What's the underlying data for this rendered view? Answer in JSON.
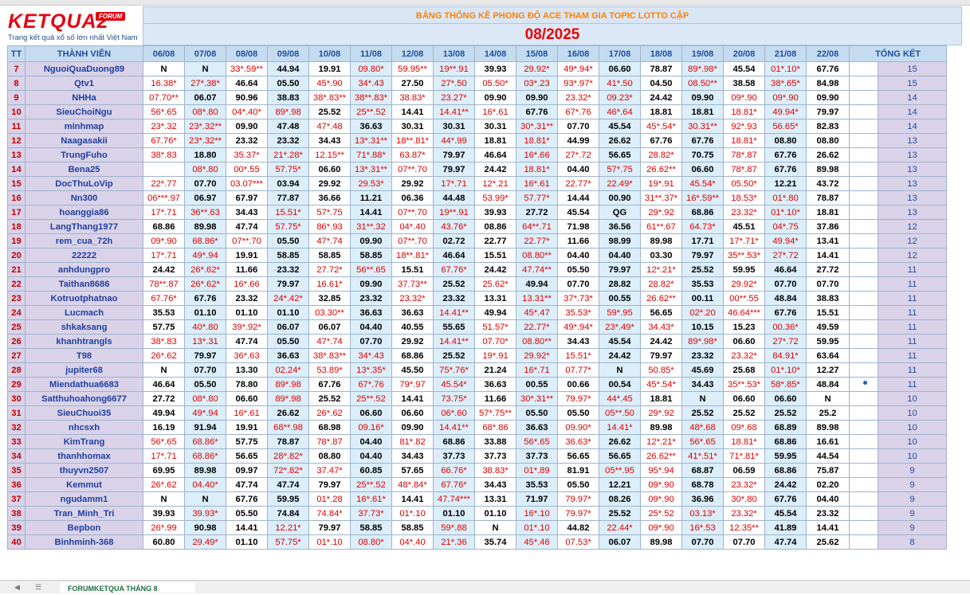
{
  "logo": {
    "main": "KETQUA2",
    "forum": "FORUM",
    "tagline": "Trang kết quả xổ số lớn nhất Việt Nam"
  },
  "title": "BẢNG THỐNG KÊ PHONG ĐỘ ACE THAM GIA TOPIC  LOTTO CẶP",
  "month": "08/2025",
  "headers": {
    "tt": "TT",
    "member": "THÀNH VIÊN",
    "total": "TỔNG KẾT"
  },
  "dates": [
    "06/08",
    "07/08",
    "08/08",
    "09/08",
    "10/08",
    "11/08",
    "12/08",
    "13/08",
    "14/08",
    "15/08",
    "16/08",
    "17/08",
    "18/08",
    "19/08",
    "20/08",
    "21/08",
    "22/08"
  ],
  "rows": [
    {
      "tt": "7",
      "name": "NguoiQuaDuong89",
      "cells": [
        "N",
        "N",
        "33*.59**",
        "44.94",
        "19.91",
        "09.80*",
        "59.95**",
        "19**.91",
        "39.93",
        "29.92*",
        "49*.94*",
        "06.60",
        "78.87",
        "89*.98*",
        "45.54",
        "01*.10*",
        "67.76"
      ],
      "total": "15"
    },
    {
      "tt": "8",
      "name": "Qtv1",
      "cells": [
        "16.38*",
        "27*.38*",
        "46.64",
        "05.50",
        "45*.90",
        "34*.43",
        "27.50",
        "27*.50",
        "05.50*",
        "03*.23",
        "93*.97*",
        "41*.50",
        "04.50",
        "08.50**",
        "38.58",
        "38*.65*",
        "84.98"
      ],
      "total": "15"
    },
    {
      "tt": "9",
      "name": "NHHa",
      "cells": [
        "07.70**",
        "06.07",
        "90.96",
        "38.83",
        "38*.83**",
        "38**.83*",
        "38.83*",
        "23.27*",
        "09.90",
        "09.90",
        "23.32*",
        "09.23*",
        "24.42",
        "09.90",
        "09*.90",
        "09*.90",
        "09.90"
      ],
      "total": "14"
    },
    {
      "tt": "10",
      "name": "SieuChoiNgu",
      "cells": [
        "56*.65",
        "08*.80",
        "04*.40*",
        "89*.98",
        "25.52",
        "25**.52",
        "14.41",
        "14.41**",
        "16*.61",
        "67.76",
        "67*.76",
        "46*.64",
        "18.81",
        "18.81",
        "18.81*",
        "49.94*",
        "79.97"
      ],
      "total": "14"
    },
    {
      "tt": "11",
      "name": "minhmap",
      "cells": [
        "23*.32",
        "23*.32**",
        "09.90",
        "47.48",
        "47*.48",
        "36.63",
        "30.31",
        "30.31",
        "30.31",
        "30*.31**",
        "07.70",
        "45.54",
        "45*.54*",
        "30.31**",
        "92*.93",
        "56.65*",
        "82.83"
      ],
      "total": "14"
    },
    {
      "tt": "12",
      "name": "Naagasakii",
      "cells": [
        "67.76*",
        "23*.32**",
        "23.32",
        "23.32",
        "34.43",
        "13*.31**",
        "18**.81*",
        "44*.99",
        "18.81",
        "18.81*",
        "44.99",
        "26.62",
        "67.76",
        "67.76",
        "18.81*",
        "08.80",
        "08.80"
      ],
      "total": "13"
    },
    {
      "tt": "13",
      "name": "TrungFuho",
      "cells": [
        "38*.83",
        "18.80",
        "35.37*",
        "21*.28*",
        "12.15**",
        "71*.88*",
        "63.87*",
        "79.97",
        "46.64",
        "16*.66",
        "27*.72",
        "56.65",
        "28.82*",
        "70.75",
        "78*.87",
        "67.76",
        "26.62"
      ],
      "total": "13"
    },
    {
      "tt": "14",
      "name": "Bena25",
      "cells": [
        "",
        "08*.80",
        "00*.55",
        "57.75*",
        "06.60",
        "13*.31**",
        "07**.70",
        "79.97",
        "24.42",
        "18.81*",
        "04.40",
        "57*.75",
        "26.62**",
        "06.60",
        "78*.87",
        "67.76",
        "89.98"
      ],
      "total": "13"
    },
    {
      "tt": "15",
      "name": "DocThuLoVip",
      "cells": [
        "22*.77",
        "07.70",
        "03.07***",
        "03.94",
        "29.92",
        "29.53*",
        "29.92",
        "17*.71",
        "12*.21",
        "16*.61",
        "22.77*",
        "22.49*",
        "19*.91",
        "45.54*",
        "05.50*",
        "12.21",
        "43.72"
      ],
      "total": "13"
    },
    {
      "tt": "16",
      "name": "Nn300",
      "cells": [
        "06***.97",
        "06.97",
        "67.97",
        "77.87",
        "36.66",
        "11.21",
        "06.36",
        "44.48",
        "53.99*",
        "57.77*",
        "14.44",
        "00.90",
        "31**.37*",
        "16*.59**",
        "18.53*",
        "01*.80",
        "78.87"
      ],
      "total": "13"
    },
    {
      "tt": "17",
      "name": "hoanggia86",
      "cells": [
        "17*.71",
        "36**.63",
        "34.43",
        "15.51*",
        "57*.75",
        "14.41",
        "07**.70",
        "19**.91",
        "39.93",
        "27.72",
        "45.54",
        "QG",
        "29*.92",
        "68.86",
        "23.32*",
        "01*.10*",
        "18.81"
      ],
      "total": "13"
    },
    {
      "tt": "18",
      "name": "LangThang1977",
      "cells": [
        "68.86",
        "89.98",
        "47.74",
        "57.75*",
        "86*.93",
        "31**.32",
        "04*.40",
        "43.76*",
        "08.86",
        "64**.71",
        "71.98",
        "36.56",
        "61**.67",
        "64.73*",
        "45.51",
        "04*.75",
        "37.86"
      ],
      "total": "12"
    },
    {
      "tt": "19",
      "name": "rem_cua_72h",
      "cells": [
        "09*.90",
        "68.86*",
        "07**.70",
        "05.50",
        "47*.74",
        "09.90",
        "07**.70",
        "02.72",
        "22.77",
        "22.77*",
        "11.66",
        "98.99",
        "89.98",
        "17.71",
        "17*.71*",
        "49.94*",
        "13.41"
      ],
      "total": "12"
    },
    {
      "tt": "20",
      "name": "22222",
      "cells": [
        "17*.71",
        "49*.94",
        "19.91",
        "58.85",
        "58.85",
        "58.85",
        "18**.81*",
        "46.64",
        "15.51",
        "08.80**",
        "04.40",
        "04.40",
        "03.30",
        "79.97",
        "35**.53*",
        "27*.72",
        "14.41"
      ],
      "total": "12"
    },
    {
      "tt": "21",
      "name": "anhdungpro",
      "cells": [
        "24.42",
        "26*.62*",
        "11.66",
        "23.32",
        "27.72*",
        "56**.65",
        "15.51",
        "67.76*",
        "24.42",
        "47.74**",
        "05.50",
        "79.97",
        "12*.21*",
        "25.52",
        "59.95",
        "46.64",
        "27.72"
      ],
      "total": "11"
    },
    {
      "tt": "22",
      "name": "Taithan8686",
      "cells": [
        "78**.87",
        "26*.62*",
        "16*.66",
        "79.97",
        "16.61*",
        "09.90",
        "37.73**",
        "25.52",
        "25.62*",
        "49.94",
        "07.70",
        "28.82",
        "28.82*",
        "35.53",
        "29.92*",
        "07.70",
        "07.70"
      ],
      "total": "11"
    },
    {
      "tt": "23",
      "name": "Kotruotphatnao",
      "cells": [
        "67.76*",
        "67.76",
        "23.32",
        "24*.42*",
        "32.85",
        "23.32",
        "23.32*",
        "23.32",
        "13.31",
        "13.31**",
        "37*.73*",
        "00.55",
        "26.62**",
        "00.11",
        "00**.55",
        "48.84",
        "38.83"
      ],
      "total": "11"
    },
    {
      "tt": "24",
      "name": "Lucmach",
      "cells": [
        "35.53",
        "01.10",
        "01.10",
        "01.10",
        "03.30**",
        "36.63",
        "36.63",
        "14.41**",
        "49.94",
        "45*.47",
        "35.53*",
        "59*.95",
        "56.65",
        "02*.20",
        "46.64***",
        "67.76",
        "15.51"
      ],
      "total": "11"
    },
    {
      "tt": "25",
      "name": "shkaksang",
      "cells": [
        "57.75",
        "40*.80",
        "39*.92*",
        "06.07",
        "06.07",
        "04.40",
        "40.55",
        "55.65",
        "51.57*",
        "22.77*",
        "49*.94*",
        "23*.49*",
        "34.43*",
        "10.15",
        "15.23",
        "00.36*",
        "49.59"
      ],
      "total": "11"
    },
    {
      "tt": "26",
      "name": "khanhtrangls",
      "cells": [
        "38*.83",
        "13*.31",
        "47.74",
        "05.50",
        "47*.74",
        "07.70",
        "29.92",
        "14.41**",
        "07.70*",
        "08.80**",
        "34.43",
        "45.54",
        "24.42",
        "89*.98*",
        "06.60",
        "27*.72",
        "59.95"
      ],
      "total": "11"
    },
    {
      "tt": "27",
      "name": "T98",
      "cells": [
        "26*.62",
        "79.97",
        "36*.63",
        "36.63",
        "38*.83**",
        "34*.43",
        "68.86",
        "25.52",
        "19*.91",
        "29.92*",
        "15.51*",
        "24.42",
        "79.97",
        "23.32",
        "23.32*",
        "84.91*",
        "63.64"
      ],
      "total": "11"
    },
    {
      "tt": "28",
      "name": "jupiter68",
      "cells": [
        "N",
        "07.70",
        "13.30",
        "02.24*",
        "53.89*",
        "13*.35*",
        "45.50",
        "75*.76*",
        "21.24",
        "16*.71",
        "07.77*",
        "N",
        "50.85*",
        "45.69",
        "25.68",
        "01*.10*",
        "12.27"
      ],
      "total": "11"
    },
    {
      "tt": "29",
      "name": "Miendathua6683",
      "cells": [
        "46.64",
        "05.50",
        "78.80",
        "89*.98",
        "67.76",
        "67*.76",
        "79*.97",
        "45.54*",
        "36.63",
        "00.55",
        "00.66",
        "00.54",
        "45*.54*",
        "34.43",
        "35**.53*",
        "58*.85*",
        "48.84"
      ],
      "total": "11"
    },
    {
      "tt": "30",
      "name": "Satthuhoahong6677",
      "cells": [
        "27.72",
        "08*.80",
        "06.60",
        "89*.98",
        "25.52",
        "25**.52",
        "14.41",
        "73.75*",
        "11.66",
        "30*.31**",
        "79.97*",
        "44*.45",
        "18.81",
        "N",
        "06.60",
        "06.60",
        "N"
      ],
      "total": "10"
    },
    {
      "tt": "31",
      "name": "SieuChuoi35",
      "cells": [
        "49.94",
        "49*.94",
        "16*.61",
        "26.62",
        "26*.62",
        "06.60",
        "06.60",
        "06*.60",
        "57*.75**",
        "05.50",
        "05.50",
        "05**.50",
        "29*.92",
        "25.52",
        "25.52",
        "25.52",
        "25.2"
      ],
      "total": "10"
    },
    {
      "tt": "32",
      "name": "nhcsxh",
      "cells": [
        "16.19",
        "91.94",
        "19.91",
        "68**.98",
        "68.98",
        "09.16*",
        "09.90",
        "14.41**",
        "68*.86",
        "36.63",
        "09.90*",
        "14.41*",
        "89.98",
        "48*.68",
        "09*.68",
        "68.89",
        "89.98"
      ],
      "total": "10"
    },
    {
      "tt": "33",
      "name": "KimTrang",
      "cells": [
        "56*.65",
        "68.86*",
        "57.75",
        "78.87",
        "78*.87",
        "04.40",
        "81*.82",
        "68.86",
        "33.88",
        "56*.65",
        "36.63*",
        "26.62",
        "12*.21*",
        "56*.65",
        "18.81*",
        "68.86",
        "16.61"
      ],
      "total": "10"
    },
    {
      "tt": "34",
      "name": "thanhhomax",
      "cells": [
        "17*.71",
        "68.86*",
        "56.65",
        "28*.82*",
        "08.80",
        "04.40",
        "34.43",
        "37.73",
        "37.73",
        "37.73",
        "56.65",
        "56.65",
        "26.62**",
        "41*.51*",
        "71*.81*",
        "59.95",
        "44.54"
      ],
      "total": "10"
    },
    {
      "tt": "35",
      "name": "thuyvn2507",
      "cells": [
        "69.95",
        "89.98",
        "09.97",
        "72*.82*",
        "37.47*",
        "60.85",
        "57.65",
        "66.76*",
        "38.83*",
        "01*.89",
        "81.91",
        "05**.95",
        "95*.94",
        "68.87",
        "06.59",
        "68.86",
        "75.87"
      ],
      "total": "9"
    },
    {
      "tt": "36",
      "name": "Kemmut",
      "cells": [
        "26*.62",
        "04.40*",
        "47.74",
        "47.74",
        "79.97",
        "25**.52",
        "48*.84*",
        "67.76*",
        "34.43",
        "35.53",
        "05.50",
        "12.21",
        "09*.90",
        "68.78",
        "23.32*",
        "24.42",
        "02.20"
      ],
      "total": "9"
    },
    {
      "tt": "37",
      "name": "ngudamm1",
      "cells": [
        "N",
        "N",
        "67.76",
        "59.95",
        "01*.28",
        "16*.61*",
        "14.41",
        "47.74***",
        "13.31",
        "71.97",
        "79.97*",
        "08.26",
        "09*.90",
        "36.96",
        "30*.80",
        "67.76",
        "04.40"
      ],
      "total": "9"
    },
    {
      "tt": "38",
      "name": "Tran_Minh_Tri",
      "cells": [
        "39.93",
        "39.93*",
        "05.50",
        "74.84",
        "74.84*",
        "37.73*",
        "01*.10",
        "01.10",
        "01.10",
        "16*.10",
        "79.97*",
        "25.52",
        "25*.52",
        "03.13*",
        "23.32*",
        "45.54",
        "23.32"
      ],
      "total": "9"
    },
    {
      "tt": "39",
      "name": "Bepbon",
      "cells": [
        "26*.99",
        "90.98",
        "14.41",
        "12.21*",
        "79.97",
        "58.85",
        "58.85",
        "59*.88",
        "N",
        "01*.10",
        "44.82",
        "22.44*",
        "09*.90",
        "16*.53",
        "12.35**",
        "41.89",
        "14.41"
      ],
      "total": "9"
    },
    {
      "tt": "40",
      "name": "Binhminh-368",
      "cells": [
        "60.80",
        "29.49*",
        "01.10",
        "57.75*",
        "01*.10",
        "08.80*",
        "04*.40",
        "21*.36",
        "35.74",
        "45*.46",
        "07.53*",
        "06.07",
        "89.98",
        "07.70",
        "07.70",
        "47.74",
        "25.62"
      ],
      "total": "8"
    }
  ],
  "sheet_tab": "FORUMKETQUA THÁNG 8"
}
